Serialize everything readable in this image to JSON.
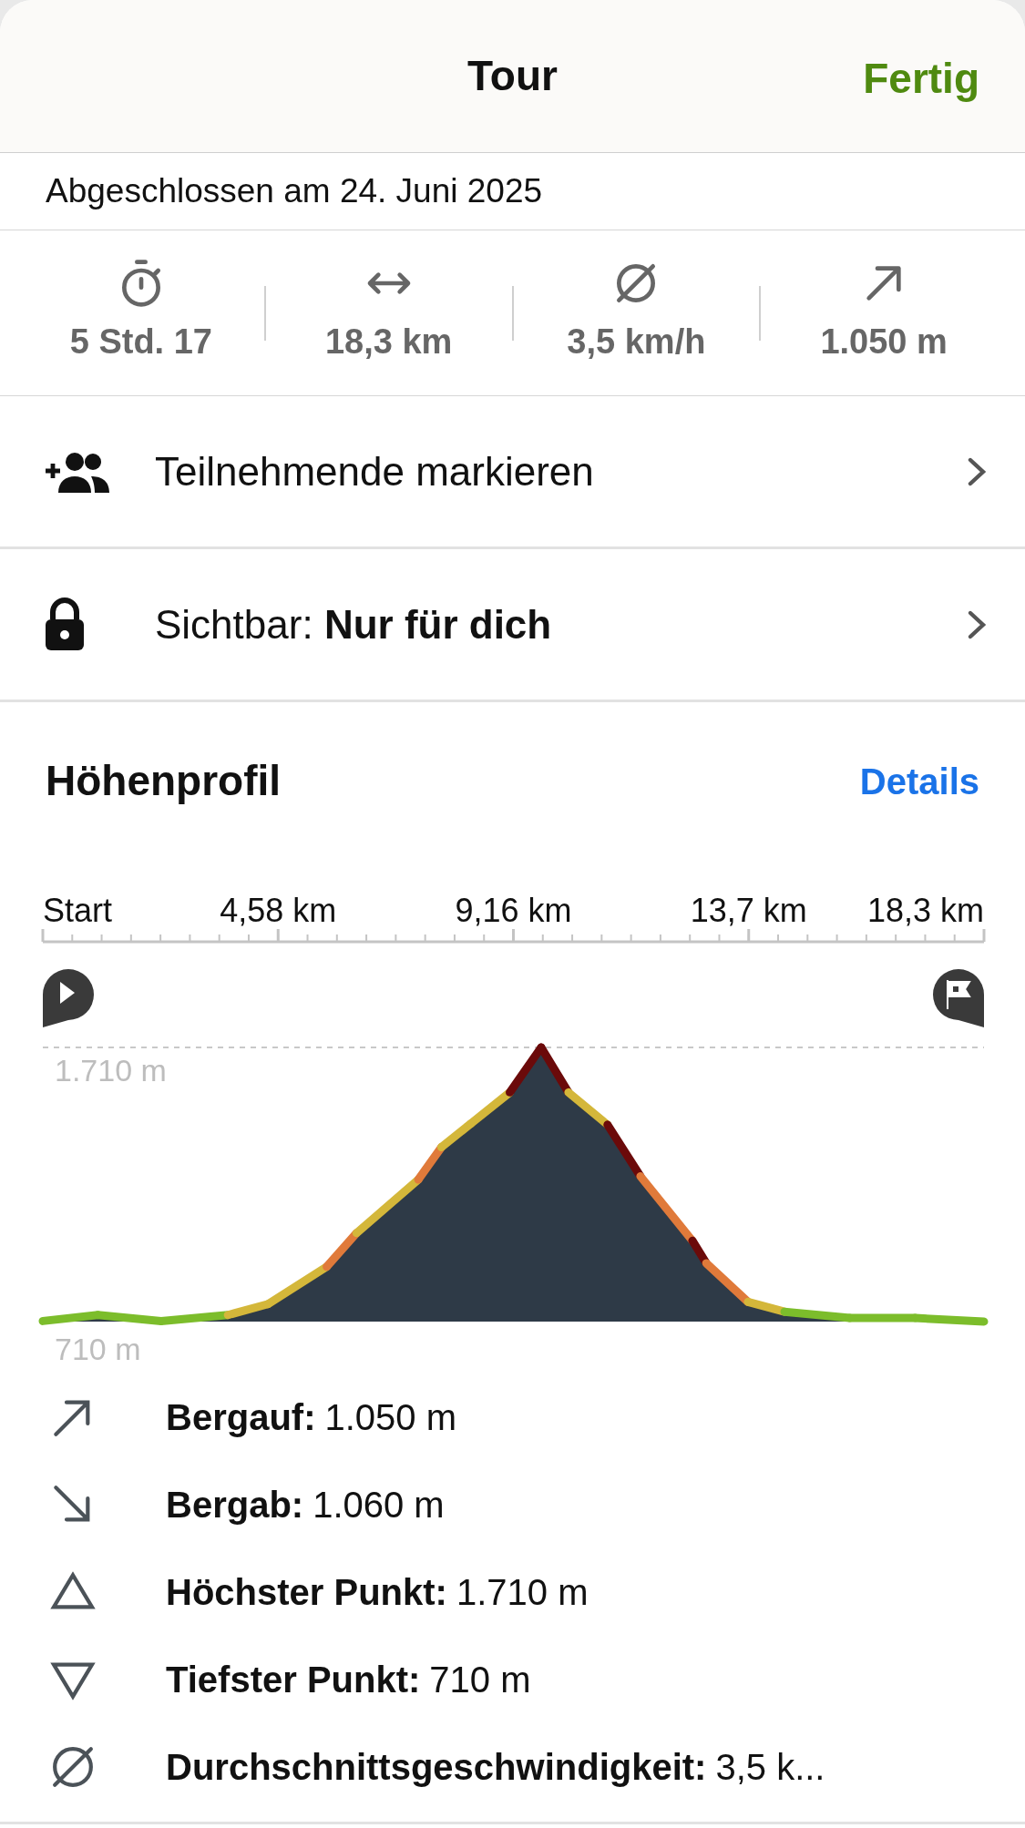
{
  "header": {
    "title": "Tour",
    "done_button": "Fertig"
  },
  "completed": "Abgeschlossen am 24. Juni 2025",
  "stats": [
    {
      "kind": "duration",
      "value": "5 Std. 17"
    },
    {
      "kind": "distance",
      "value": "18,3 km"
    },
    {
      "kind": "speed",
      "value": "3,5 km/h"
    },
    {
      "kind": "ascent",
      "value": "1.050 m"
    }
  ],
  "actions": [
    {
      "kind": "people",
      "label": "Teilnehmende markieren"
    },
    {
      "kind": "lock",
      "label": "Sichtbar: **Nur für dich**"
    }
  ],
  "elevation": {
    "title": "Höhenprofil",
    "details_link": "Details",
    "distance_labels": [
      "Start",
      "4,58 km",
      "9,16 km",
      "13,7 km",
      "18,3 km"
    ],
    "max_elevation": "1.710 m",
    "min_elevation": "710 m"
  },
  "summary": [
    {
      "kind": "up",
      "label": "Bergauf:",
      "value": "1.050 m"
    },
    {
      "kind": "down",
      "label": "Bergab:",
      "value": "1.060 m"
    },
    {
      "kind": "highest",
      "label": "Höchster Punkt:",
      "value": "1.710 m"
    },
    {
      "kind": "lowest",
      "label": "Tiefster Punkt:",
      "value": "710 m"
    },
    {
      "kind": "average",
      "label": "Durchschnittsgeschwindigkeit:",
      "value": "3,5 k..."
    }
  ]
}
